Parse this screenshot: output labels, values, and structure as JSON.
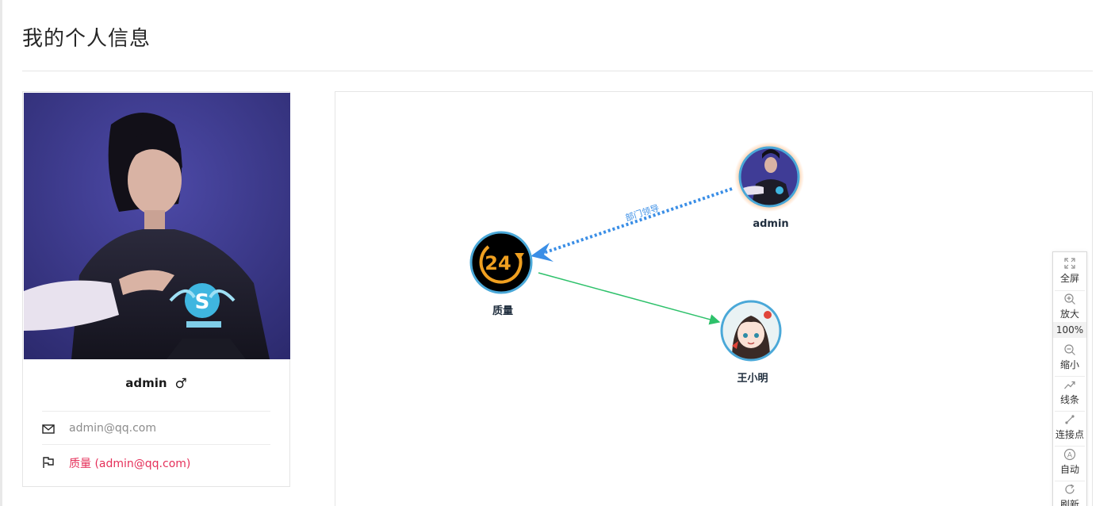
{
  "page": {
    "title": "我的个人信息"
  },
  "profile": {
    "name": "admin",
    "gender_symbol": "♂",
    "email": "admin@qq.com",
    "department": "质量 (admin@qq.com)"
  },
  "graph": {
    "nodes": [
      {
        "id": "admin",
        "label": "admin",
        "avatar": "photo"
      },
      {
        "id": "quality",
        "label": "质量",
        "avatar": "24-hour-icon"
      },
      {
        "id": "wang",
        "label": "王小明",
        "avatar": "cartoon-girl"
      }
    ],
    "edges": [
      {
        "from": "admin",
        "to": "quality",
        "label": "部门领导",
        "style": "dotted",
        "color": "#3a8ee6"
      },
      {
        "from": "quality",
        "to": "wang",
        "label": "",
        "style": "solid",
        "color": "#2ec16b"
      }
    ]
  },
  "toolbar": {
    "fullscreen": "全屏",
    "zoom_in": "放大",
    "zoom_level": "100%",
    "zoom_out": "缩小",
    "lines": "线条",
    "connect_points": "连接点",
    "auto": "自动",
    "refresh": "刷新"
  }
}
